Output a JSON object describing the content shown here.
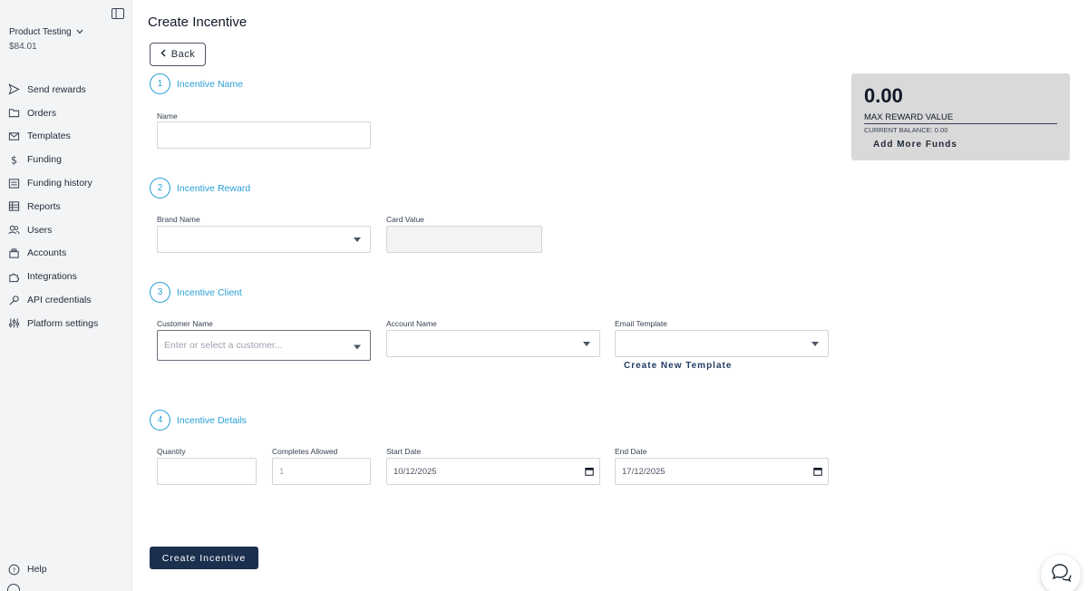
{
  "sidebar": {
    "org_name": "Product Testing",
    "org_balance": "$84.01",
    "items": [
      {
        "label": "Send rewards",
        "icon": "send-icon"
      },
      {
        "label": "Orders",
        "icon": "folder-icon"
      },
      {
        "label": "Templates",
        "icon": "mail-icon"
      },
      {
        "label": "Funding",
        "icon": "dollar-icon"
      },
      {
        "label": "Funding history",
        "icon": "list-icon"
      },
      {
        "label": "Reports",
        "icon": "table-icon"
      },
      {
        "label": "Users",
        "icon": "users-icon"
      },
      {
        "label": "Accounts",
        "icon": "stack-icon"
      },
      {
        "label": "Integrations",
        "icon": "puzzle-icon"
      },
      {
        "label": "API credentials",
        "icon": "key-icon"
      },
      {
        "label": "Platform settings",
        "icon": "sliders-icon"
      }
    ],
    "help_label": "Help"
  },
  "page": {
    "title": "Create Incentive",
    "back_label": "Back"
  },
  "steps": [
    {
      "num": "1",
      "label": "Incentive Name"
    },
    {
      "num": "2",
      "label": "Incentive Reward"
    },
    {
      "num": "3",
      "label": "Incentive Client"
    },
    {
      "num": "4",
      "label": "Incentive Details"
    }
  ],
  "fields": {
    "name_label": "Name",
    "brand_label": "Brand Name",
    "card_value_label": "Card Value",
    "customer_label": "Customer Name",
    "customer_placeholder": "Enter or select a customer...",
    "account_label": "Account Name",
    "email_template_label": "Email Template",
    "create_template_label": "Create New Template",
    "quantity_label": "Quantity",
    "completes_label": "Completes Allowed",
    "completes_value": "1",
    "start_label": "Start Date",
    "start_value": "10/12/2025",
    "end_label": "End Date",
    "end_value": "17/12/2025"
  },
  "summary": {
    "value": "0.00",
    "max_label": "MAX REWARD VALUE",
    "balance_label": "CURRENT BALANCE: 0.00",
    "add_funds_label": "Add More Funds"
  },
  "submit_label": "Create Incentive",
  "colors": {
    "accent": "#2a9fd6",
    "primary_button": "#1b2f4e",
    "sidebar_bg": "#f3f4f6"
  }
}
